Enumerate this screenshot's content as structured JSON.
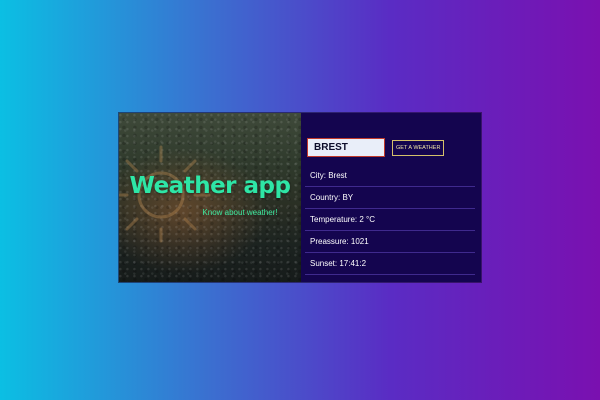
{
  "hero": {
    "title": "Weather app",
    "subtitle": "Know about weather!"
  },
  "search": {
    "value": "BREST",
    "button_label": "GET A WEATHER"
  },
  "info": {
    "rows": [
      "City: Brest",
      "Country: BY",
      "Temperature: 2 °C",
      "Preassure: 1021",
      "Sunset: 17:41:2"
    ]
  },
  "colors": {
    "accent_green": "#2ee6a6",
    "panel_bg": "#14054f",
    "button_border": "#d4c06a"
  }
}
